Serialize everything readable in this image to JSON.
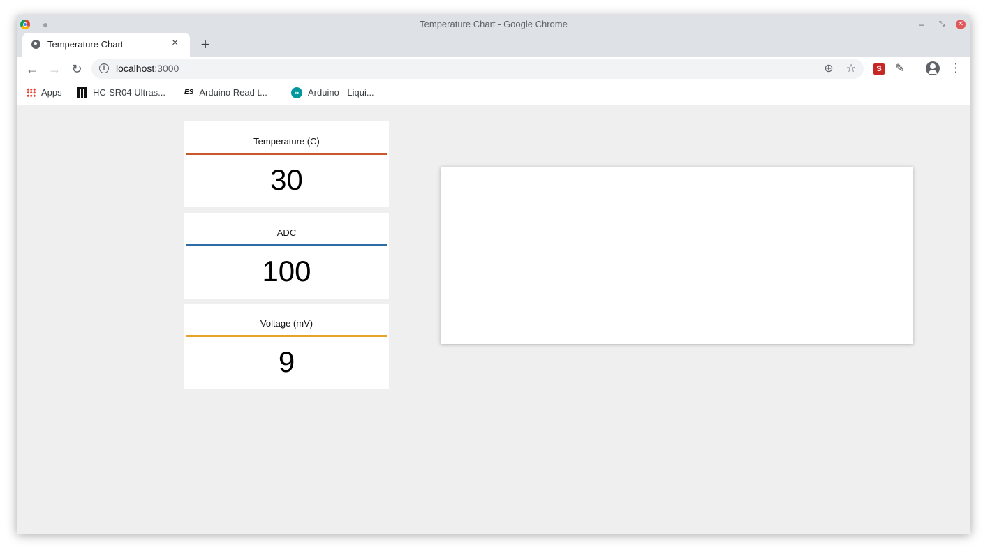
{
  "window": {
    "title": "Temperature Chart - Google Chrome"
  },
  "tabs": [
    {
      "label": "Temperature Chart",
      "active": true
    }
  ],
  "address_bar": {
    "host": "localhost",
    "port": ":3000"
  },
  "bookmarks": [
    {
      "label": "Apps",
      "icon": "apps-grid-icon"
    },
    {
      "label": "HC-SR04 Ultras...",
      "icon": "hc-favicon-icon"
    },
    {
      "label": "Arduino Read t...",
      "icon": "es-favicon-icon"
    },
    {
      "label": "Arduino - Liqui...",
      "icon": "arduino-favicon-icon"
    }
  ],
  "cards": [
    {
      "label": "Temperature (C)",
      "value": "30",
      "color": "#c8572b"
    },
    {
      "label": "ADC",
      "value": "100",
      "color": "#2e6da4"
    },
    {
      "label": "Voltage (mV)",
      "value": "9",
      "color": "#e5a429"
    }
  ],
  "colors": {
    "page_bg": "#efefef",
    "titlebar": "#dee1e6"
  }
}
